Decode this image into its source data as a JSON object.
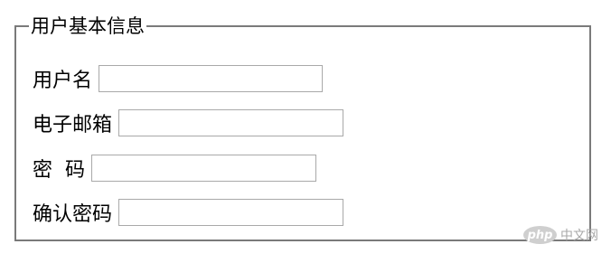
{
  "form": {
    "legend": "用户基本信息",
    "fields": [
      {
        "label": "用户名",
        "value": ""
      },
      {
        "label": "电子邮箱",
        "value": ""
      },
      {
        "label": "密  码",
        "value": ""
      },
      {
        "label": "确认密码",
        "value": ""
      }
    ]
  },
  "watermark": {
    "logo": "php",
    "text": "中文网"
  }
}
